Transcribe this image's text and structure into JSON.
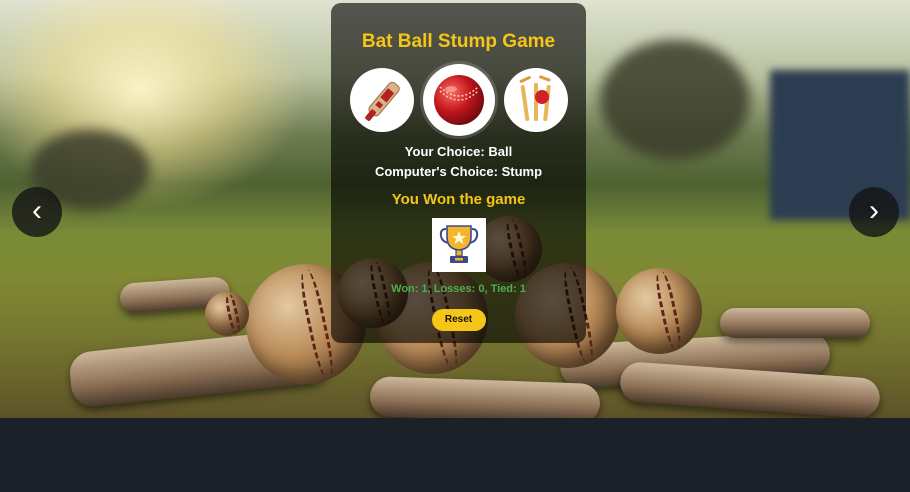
{
  "game": {
    "title": "Bat Ball Stump Game",
    "choices": [
      {
        "name": "Bat",
        "icon": "bat-icon"
      },
      {
        "name": "Ball",
        "icon": "ball-icon"
      },
      {
        "name": "Stump",
        "icon": "stump-icon"
      }
    ],
    "your_choice": "Your Choice: Ball",
    "computer_choice": "Computer's Choice: Stump",
    "result": "You Won the game",
    "result_icon": "trophy-icon",
    "score": "Won: 1, Losses: 0, Tied: 1",
    "reset_label": "Reset"
  },
  "carousel": {
    "prev_label": "‹",
    "next_label": "›"
  },
  "colors": {
    "accent": "#f5c518",
    "score": "#4caf50",
    "footer": "#1b2029"
  }
}
